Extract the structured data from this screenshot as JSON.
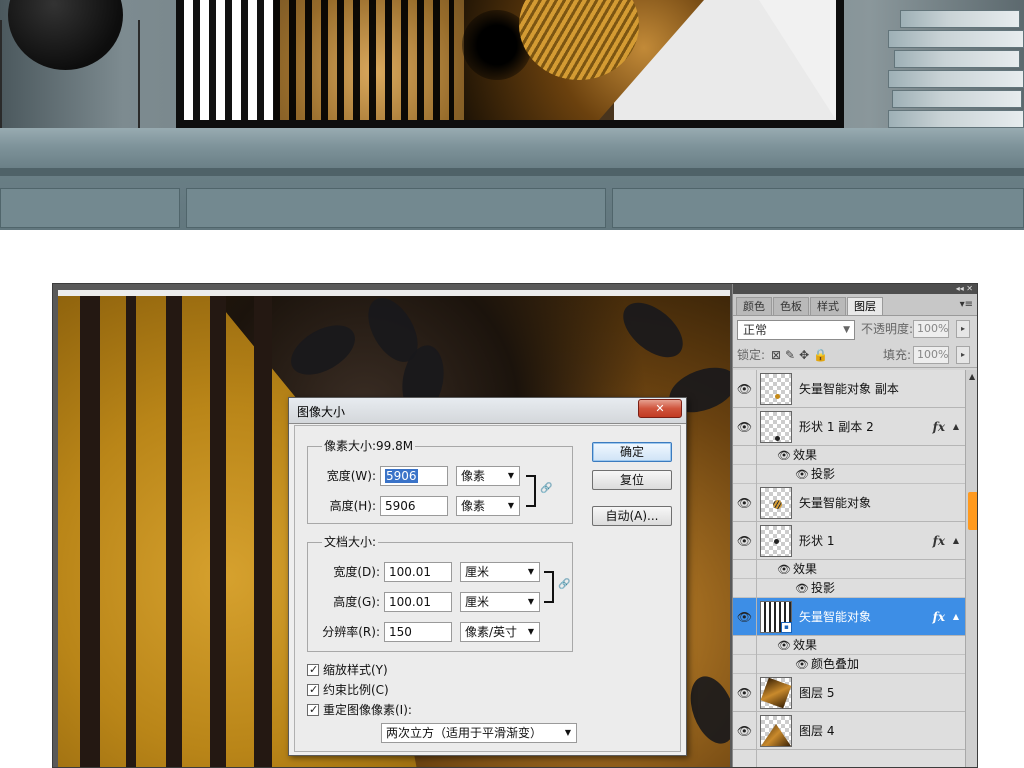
{
  "dialog": {
    "title": "图像大小",
    "close_label": "✕",
    "pixel_dimensions": {
      "legend": "像素大小:99.8M",
      "width_label": "宽度(W):",
      "width_value": "5906",
      "width_unit": "像素",
      "height_label": "高度(H):",
      "height_value": "5906",
      "height_unit": "像素"
    },
    "document_size": {
      "legend": "文档大小:",
      "width_label": "宽度(D):",
      "width_value": "100.01",
      "width_unit": "厘米",
      "height_label": "高度(G):",
      "height_value": "100.01",
      "height_unit": "厘米",
      "resolution_label": "分辨率(R):",
      "resolution_value": "150",
      "resolution_unit": "像素/英寸"
    },
    "buttons": {
      "ok": "确定",
      "reset": "复位",
      "auto": "自动(A)..."
    },
    "checkboxes": {
      "scale_styles": "缩放样式(Y)",
      "constrain_proportions": "约束比例(C)",
      "resample": "重定图像像素(I):"
    },
    "resample_method": "两次立方（适用于平滑渐变）"
  },
  "layers_panel": {
    "tabs": [
      "颜色",
      "色板",
      "样式",
      "图层"
    ],
    "active_tab": "图层",
    "blend_mode": "正常",
    "opacity_label": "不透明度:",
    "opacity_value": "100%",
    "lock_label": "锁定:",
    "fill_label": "填充:",
    "fill_value": "100%",
    "layers": [
      {
        "name": "矢量智能对象 副本",
        "fx": ""
      },
      {
        "name": "形状 1 副本 2",
        "fx": "fx",
        "effects_label": "效果",
        "effect": "投影"
      },
      {
        "name": "矢量智能对象",
        "fx": ""
      },
      {
        "name": "形状 1",
        "fx": "fx",
        "effects_label": "效果",
        "effect": "投影"
      },
      {
        "name": "矢量智能对象",
        "fx": "fx",
        "effects_label": "效果",
        "effect": "颜色叠加",
        "selected": true
      },
      {
        "name": "图层 5",
        "fx": ""
      },
      {
        "name": "图层 4",
        "fx": ""
      }
    ]
  },
  "colors": {
    "selected_layer": "#3d8ee6",
    "scroll_thumb": "#ff9a1f",
    "close_button": "#d0543c"
  }
}
